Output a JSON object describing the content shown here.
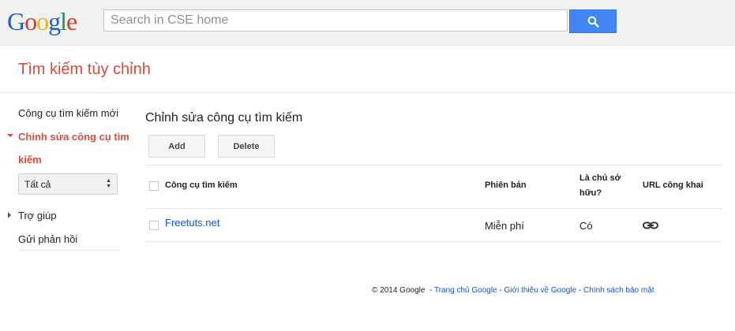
{
  "header": {
    "logo_letters": [
      "G",
      "o",
      "o",
      "g",
      "l",
      "e"
    ],
    "search_placeholder": "Search in CSE home"
  },
  "app_title": "Tìm kiếm tùy chỉnh",
  "sidebar": {
    "new_engine": "Công cụ tìm kiếm mới",
    "edit_engine": "Chỉnh sửa công cụ tìm kiếm",
    "filter_selected": "Tất cả",
    "help": "Trợ giúp",
    "feedback": "Gửi phản hồi"
  },
  "main": {
    "title": "Chỉnh sửa công cụ tìm kiếm",
    "add_label": "Add",
    "delete_label": "Delete",
    "columns": {
      "engine": "Công cụ tìm kiếm",
      "edition": "Phiên bản",
      "owner": "Là chủ sở hữu?",
      "public_url": "URL công khai"
    },
    "rows": [
      {
        "engine": "Freetuts.net",
        "edition": "Miễn phí",
        "owner": "Có"
      }
    ]
  },
  "footer": {
    "copyright": "© 2014 Google",
    "sep": "-",
    "links": [
      "Trang chủ Google",
      "Giới thiệu về Google",
      "Chính sách bảo mật"
    ]
  },
  "colors": {
    "accent_red": "#dd4b39",
    "search_blue": "#4285f4",
    "link_blue": "#1155cc"
  }
}
